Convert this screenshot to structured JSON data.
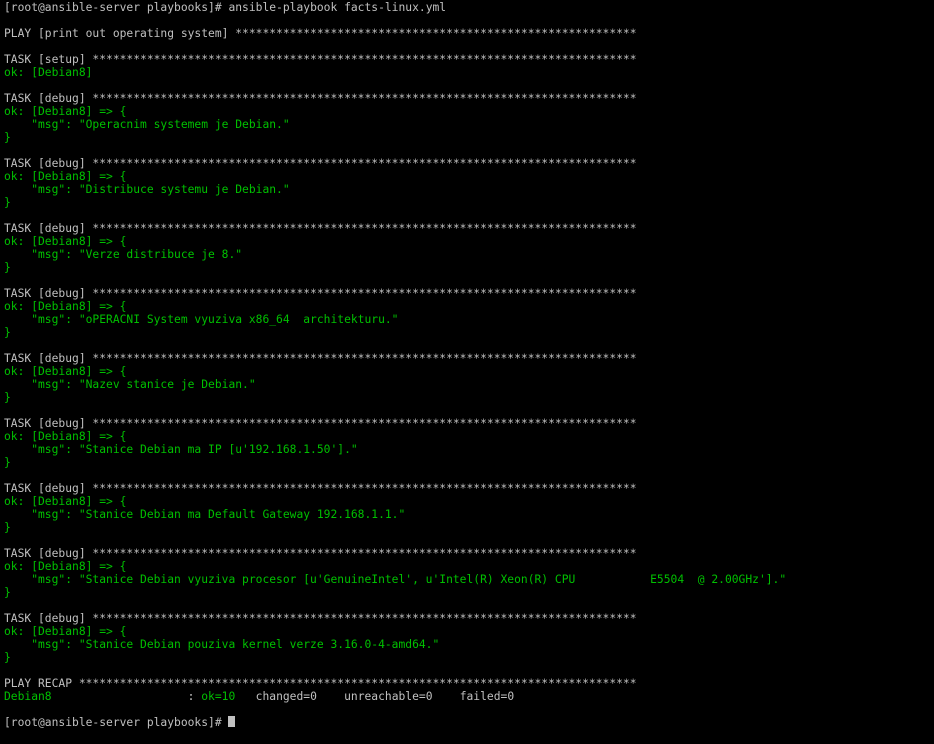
{
  "colors": {
    "background": "#000000",
    "default_text": "#c0c0c0",
    "ok": "#00c000",
    "warn": "#c0c000"
  },
  "terminal": {
    "lines": [
      {
        "type": "cmd",
        "prompt": "[root@ansible-server playbooks]# ",
        "command": "ansible-playbook facts-linux.yml"
      },
      {
        "type": "blank"
      },
      {
        "type": "plain",
        "text": "PLAY [print out operating system] ***********************************************************"
      },
      {
        "type": "blank"
      },
      {
        "type": "plain",
        "text": "TASK [setup] ********************************************************************************"
      },
      {
        "type": "ok",
        "text": "ok: [Debian8]"
      },
      {
        "type": "blank"
      },
      {
        "type": "plain",
        "text": "TASK [debug] ********************************************************************************"
      },
      {
        "type": "ok",
        "text": "ok: [Debian8] => {"
      },
      {
        "type": "ok",
        "text": "    \"msg\": \"Operacnim systemem je Debian.\""
      },
      {
        "type": "ok",
        "text": "}"
      },
      {
        "type": "blank"
      },
      {
        "type": "plain",
        "text": "TASK [debug] ********************************************************************************"
      },
      {
        "type": "ok",
        "text": "ok: [Debian8] => {"
      },
      {
        "type": "ok",
        "text": "    \"msg\": \"Distribuce systemu je Debian.\""
      },
      {
        "type": "ok",
        "text": "}"
      },
      {
        "type": "blank"
      },
      {
        "type": "plain",
        "text": "TASK [debug] ********************************************************************************"
      },
      {
        "type": "ok",
        "text": "ok: [Debian8] => {"
      },
      {
        "type": "ok",
        "text": "    \"msg\": \"Verze distribuce je 8.\""
      },
      {
        "type": "ok",
        "text": "}"
      },
      {
        "type": "blank"
      },
      {
        "type": "plain",
        "text": "TASK [debug] ********************************************************************************"
      },
      {
        "type": "ok",
        "text": "ok: [Debian8] => {"
      },
      {
        "type": "ok",
        "text": "    \"msg\": \"oPERACNI System vyuziva x86_64  architekturu.\""
      },
      {
        "type": "ok",
        "text": "}"
      },
      {
        "type": "blank"
      },
      {
        "type": "plain",
        "text": "TASK [debug] ********************************************************************************"
      },
      {
        "type": "ok",
        "text": "ok: [Debian8] => {"
      },
      {
        "type": "ok",
        "text": "    \"msg\": \"Nazev stanice je Debian.\""
      },
      {
        "type": "ok",
        "text": "}"
      },
      {
        "type": "blank"
      },
      {
        "type": "plain",
        "text": "TASK [debug] ********************************************************************************"
      },
      {
        "type": "ok",
        "text": "ok: [Debian8] => {"
      },
      {
        "type": "ok",
        "text": "    \"msg\": \"Stanice Debian ma IP [u'192.168.1.50'].\""
      },
      {
        "type": "ok",
        "text": "}"
      },
      {
        "type": "blank"
      },
      {
        "type": "plain",
        "text": "TASK [debug] ********************************************************************************"
      },
      {
        "type": "ok",
        "text": "ok: [Debian8] => {"
      },
      {
        "type": "ok",
        "text": "    \"msg\": \"Stanice Debian ma Default Gateway 192.168.1.1.\""
      },
      {
        "type": "ok",
        "text": "}"
      },
      {
        "type": "blank"
      },
      {
        "type": "plain",
        "text": "TASK [debug] ********************************************************************************"
      },
      {
        "type": "ok",
        "text": "ok: [Debian8] => {"
      },
      {
        "type": "ok",
        "text": "    \"msg\": \"Stanice Debian vyuziva procesor [u'GenuineIntel', u'Intel(R) Xeon(R) CPU           E5504  @ 2.00GHz'].\""
      },
      {
        "type": "ok",
        "text": "}"
      },
      {
        "type": "blank"
      },
      {
        "type": "plain",
        "text": "TASK [debug] ********************************************************************************"
      },
      {
        "type": "ok",
        "text": "ok: [Debian8] => {"
      },
      {
        "type": "ok",
        "text": "    \"msg\": \"Stanice Debian pouziva kernel verze 3.16.0-4-amd64.\""
      },
      {
        "type": "ok",
        "text": "}"
      },
      {
        "type": "blank"
      },
      {
        "type": "plain",
        "text": "PLAY RECAP **********************************************************************************"
      },
      {
        "type": "recap",
        "host": "Debian8",
        "sep": "                    : ",
        "ok": "ok=10",
        "rest": "   changed=0    unreachable=0    failed=0"
      },
      {
        "type": "blank"
      },
      {
        "type": "prompt",
        "prompt": "[root@ansible-server playbooks]# "
      }
    ]
  }
}
